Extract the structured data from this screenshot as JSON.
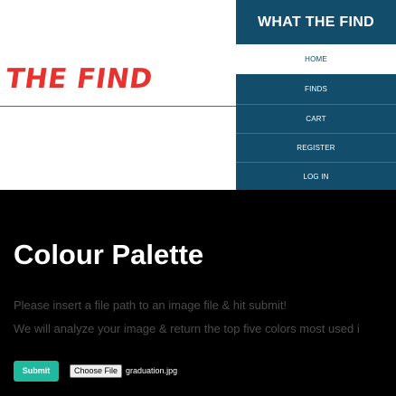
{
  "header": {
    "logo_text": "THE FIND",
    "brand": "WHAT THE FIND"
  },
  "nav": {
    "items": [
      {
        "label": "HOME",
        "active": true
      },
      {
        "label": "FINDS",
        "active": false
      },
      {
        "label": "CART",
        "active": false
      },
      {
        "label": "REGISTER",
        "active": false
      },
      {
        "label": "LOG IN",
        "active": false
      }
    ]
  },
  "main": {
    "title": "Colour Palette",
    "description_line1": "Please insert a file path to an image file & hit submit!",
    "description_line2": "We will analyze your image & return the top five colors most used i",
    "submit_label": "Submit",
    "file_button_label": "Choose File",
    "file_name": "graduation.jpg"
  },
  "colors": {
    "nav_bg": "#124d6c",
    "logo": "#e8322f",
    "submit": "#1eb99e",
    "main_bg": "#000000"
  }
}
